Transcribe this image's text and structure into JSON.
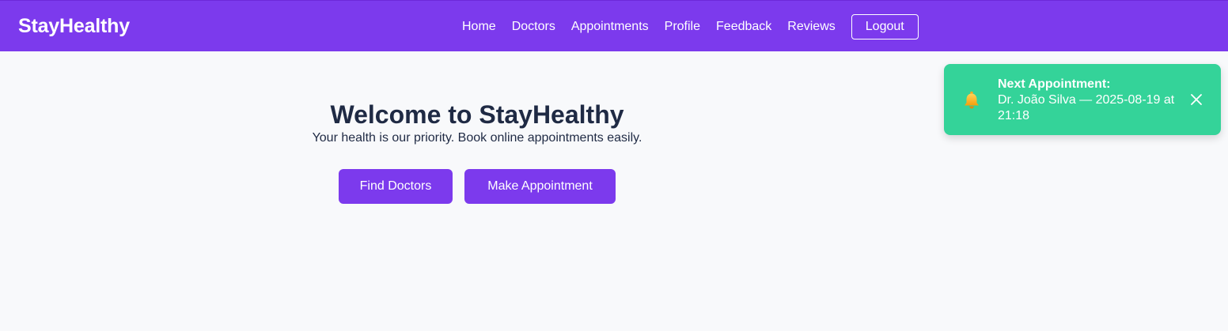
{
  "navbar": {
    "brand": "StayHealthy",
    "links": [
      "Home",
      "Doctors",
      "Appointments",
      "Profile",
      "Feedback",
      "Reviews"
    ],
    "logout_label": "Logout",
    "background_color": "#7c3aed"
  },
  "hero": {
    "title": "Welcome to StayHealthy",
    "subtitle": "Your health is our priority. Book online appointments easily.",
    "find_doctors_label": "Find Doctors",
    "make_appointment_label": "Make Appointment"
  },
  "notification": {
    "icon": "bell-icon",
    "heading": "Next Appointment:",
    "detail": "Dr. João Silva — 2025-08-19 at 21:18",
    "close_icon": "close-icon",
    "background_color": "#34d399"
  }
}
